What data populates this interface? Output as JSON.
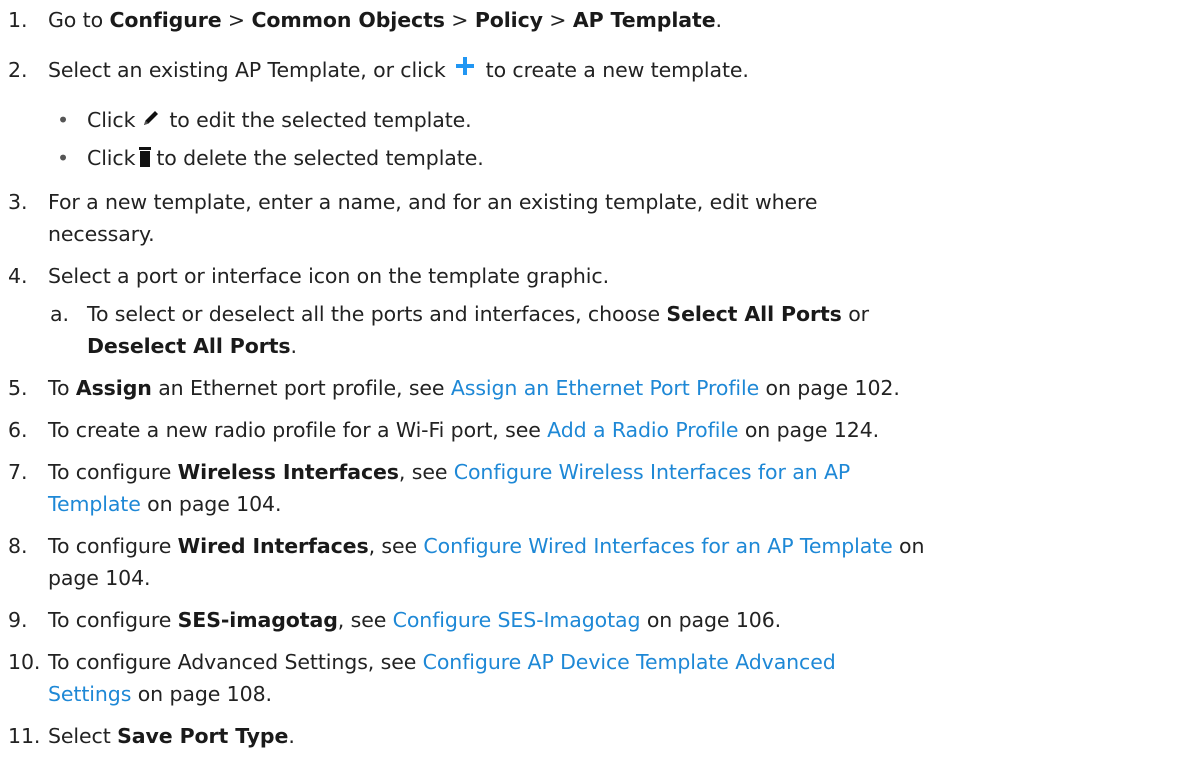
{
  "steps": {
    "s1": {
      "num": "1.",
      "pre": "Go to ",
      "b1": "Configure",
      "sep1": " > ",
      "b2": "Common Objects",
      "sep2": " > ",
      "b3": "Policy",
      "sep3": " > ",
      "b4": "AP Template",
      "post": "."
    },
    "s2": {
      "num": "2.",
      "pre": "Select an existing AP Template, or click",
      "post": "to create a new template.",
      "icon": "plus-icon",
      "icon_color": "#2196f3"
    },
    "s2a": {
      "pre": "Click",
      "post": "to edit the selected template.",
      "icon": "pencil-icon"
    },
    "s2b": {
      "pre": "Click",
      "post": "to delete the selected template.",
      "icon": "trash-icon"
    },
    "s3": {
      "num": "3.",
      "line1": "For a new template, enter a name, and for an existing template, edit where",
      "line2": "necessary."
    },
    "s4": {
      "num": "4.",
      "text": "Select a port or interface icon on the template graphic."
    },
    "s4a": {
      "num": "a.",
      "pre": "To select or deselect all the ports and interfaces, choose ",
      "b1": "Select All Ports",
      "mid": " or",
      "b2": "Deselect All Ports",
      "post": "."
    },
    "s5": {
      "num": "5.",
      "pre": "To ",
      "b1": "Assign",
      "mid": " an Ethernet port profile, see ",
      "link": "Assign an Ethernet Port Profile",
      "post": " on page 102."
    },
    "s6": {
      "num": "6.",
      "pre": "To create a new radio profile for a Wi-Fi port, see ",
      "link": "Add a Radio Profile",
      "post": " on page 124."
    },
    "s7": {
      "num": "7.",
      "pre": "To configure ",
      "b1": "Wireless Interfaces",
      "mid": ", see ",
      "link1": "Configure Wireless Interfaces for an AP",
      "link2": "Template",
      "post": " on page 104."
    },
    "s8": {
      "num": "8.",
      "pre": "To configure ",
      "b1": "Wired Interfaces",
      "mid": ", see ",
      "link": "Configure Wired Interfaces for an AP Template",
      "post1": " on",
      "post2": "page 104."
    },
    "s9": {
      "num": "9.",
      "pre": "To configure ",
      "b1": "SES-imagotag",
      "mid": ", see ",
      "link": "Configure SES-Imagotag",
      "post": " on page 106."
    },
    "s10": {
      "num": "10.",
      "pre": "To configure Advanced Settings, see ",
      "link1": "Configure AP Device Template Advanced",
      "link2": "Settings",
      "post": " on page 108."
    },
    "s11": {
      "num": "11.",
      "pre": "Select ",
      "b1": "Save Port Type",
      "post": "."
    }
  },
  "colors": {
    "link": "#1e88d6",
    "text": "#222222",
    "plus": "#2196f3"
  }
}
